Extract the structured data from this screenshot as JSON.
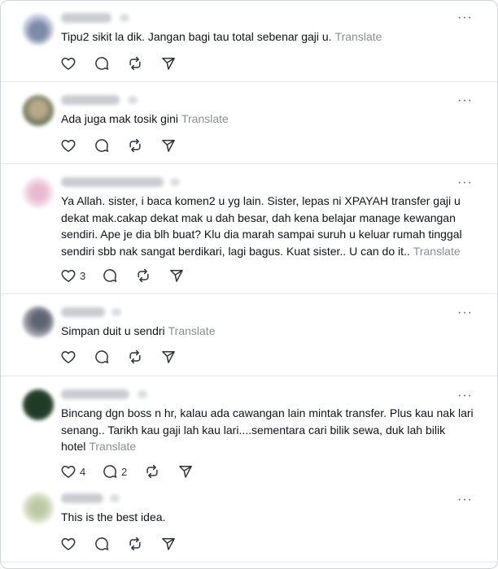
{
  "replies": [
    {
      "text": "Tipu2 sikit la dik. Jangan bagi tau total sebenar gaji u.",
      "translate": "Translate",
      "more": "···",
      "likes": "",
      "comments": ""
    },
    {
      "text": "Ada juga mak tosik gini",
      "translate": "Translate",
      "more": "···",
      "likes": "",
      "comments": ""
    },
    {
      "text": "Ya Allah. sister, i baca komen2 u yg lain. Sister, lepas ni XPAYAH transfer gaji u dekat mak.cakap dekat mak u dah besar, dah kena belajar manage kewangan sendiri. Ape je dia blh buat? Klu dia marah sampai suruh u keluar rumah tinggal sendiri sbb nak sangat berdikari, lagi bagus. Kuat sister.. U can do it..",
      "translate": "Translate",
      "more": "···",
      "likes": "3",
      "comments": ""
    },
    {
      "text": "Simpan duit u sendri",
      "translate": "Translate",
      "more": "···",
      "likes": "",
      "comments": ""
    },
    {
      "text": "Bincang dgn boss n hr, kalau ada cawangan lain mintak transfer. Plus kau nak lari senang.. Tarikh kau gaji lah kau lari....sementara cari bilik sewa, duk lah bilik hotel",
      "translate": "Translate",
      "more": "···",
      "likes": "4",
      "comments": "2"
    },
    {
      "text": "This is the best idea.",
      "translate": "",
      "more": "···",
      "likes": "",
      "comments": ""
    }
  ],
  "icons": {
    "like": "heart-icon",
    "comment": "comment-icon",
    "repost": "repost-icon",
    "share": "send-icon"
  },
  "colors": {
    "text": "#0f1419",
    "translate": "#8a8f94",
    "icon": "#2f3336",
    "divider": "#e6e9ec"
  }
}
